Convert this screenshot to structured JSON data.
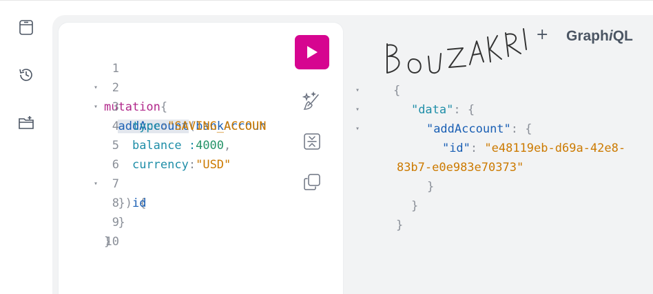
{
  "app": {
    "brand_prefix": "Graph",
    "brand_em": "i",
    "brand_suffix": "QL",
    "add_tab": "+"
  },
  "signature": "BOUZAKRI",
  "sidebar": {
    "items": [
      {
        "icon": "document-icon"
      },
      {
        "icon": "history-icon"
      },
      {
        "icon": "folder-add-icon"
      }
    ]
  },
  "editor": {
    "lines": [
      {
        "n": "1",
        "fold": "▾"
      },
      {
        "n": "2",
        "fold": "▾"
      },
      {
        "n": "3",
        "fold": ""
      },
      {
        "n": "4",
        "fold": ""
      },
      {
        "n": "5",
        "fold": ""
      },
      {
        "n": "6",
        "fold": "▾"
      },
      {
        "n": "7",
        "fold": ""
      },
      {
        "n": "8",
        "fold": ""
      },
      {
        "n": "9",
        "fold": ""
      },
      {
        "n": "10",
        "fold": ""
      }
    ],
    "tokens": {
      "mutation": "mutation",
      "open_brace": "{",
      "addAccount": "addAccount",
      "paren_open": "(",
      "arg_name": "bankAccoun",
      "type_key": "type",
      "colon": ":",
      "type_val": "\"SAVING_ACCOUN",
      "balance_key": "balance :",
      "balance_val": "4000",
      "comma": ",",
      "currency_key": "currency",
      "currency_val": "\"USD\"",
      "close_args": "}) {",
      "field_id": "id",
      "close_inner": "}",
      "close_outer": "}"
    }
  },
  "result": {
    "open": "{",
    "data_key": "\"data\"",
    "colon": ": ",
    "brace": "{",
    "add_key": "\"addAccount\"",
    "id_key": "\"id\"",
    "id_val_1": "\"e48119eb-d69a-42e8-",
    "id_val_2": "83b7-e0e983e70373\"",
    "close": "}",
    "folds": [
      "▾",
      "▾",
      "▾"
    ]
  },
  "colors": {
    "run": "#d60590",
    "keyword": "#b1278a",
    "field": "#1a5fb4",
    "string": "#cc7a00",
    "number": "#269469",
    "key": "#1f8ea8"
  }
}
